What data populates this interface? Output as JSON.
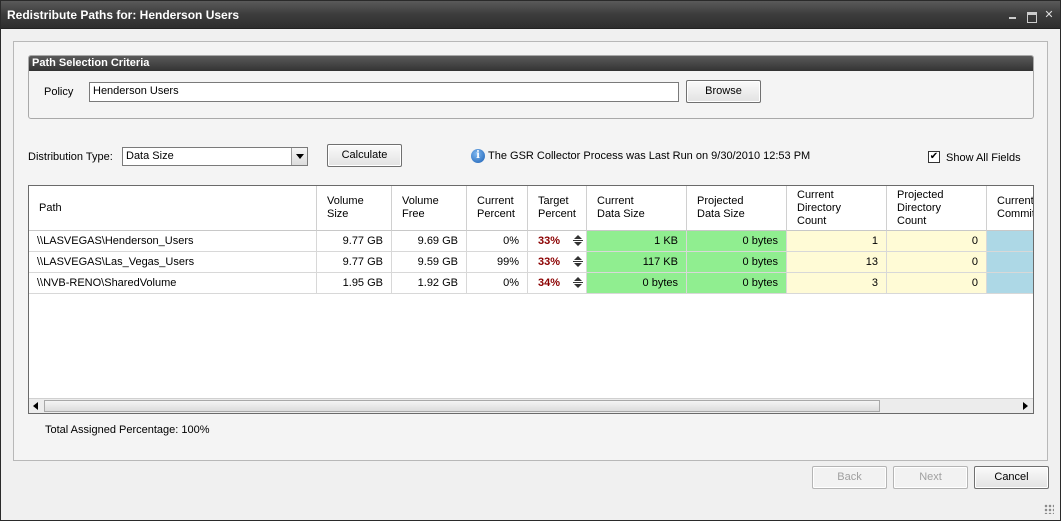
{
  "window": {
    "title": "Redistribute Paths for: Henderson Users"
  },
  "criteria": {
    "header": "Path Selection Criteria",
    "policy_label": "Policy",
    "policy_value": "Henderson Users",
    "browse_label": "Browse"
  },
  "distribution": {
    "label": "Distribution Type:",
    "selected": "Data Size",
    "calculate_label": "Calculate"
  },
  "info_message": "The GSR Collector Process was Last Run on 9/30/2010 12:53 PM",
  "show_all_fields": {
    "label": "Show All Fields",
    "checked": true
  },
  "grid": {
    "columns": [
      "Path",
      "Volume\nSize",
      "Volume\nFree",
      "Current\nPercent",
      "Target\nPercent",
      "Current\nData Size",
      "Projected\nData Size",
      "Current\nDirectory\nCount",
      "Projected\nDirectory\nCount",
      "Current\nCommit"
    ],
    "rows": [
      {
        "path": "\\\\LASVEGAS\\Henderson_Users",
        "volume_size": "9.77 GB",
        "volume_free": "9.69 GB",
        "current_percent": "0%",
        "target_percent": "33%",
        "current_data_size": "1 KB",
        "projected_data_size": "0 bytes",
        "current_dir_count": "1",
        "projected_dir_count": "0"
      },
      {
        "path": "\\\\LASVEGAS\\Las_Vegas_Users",
        "volume_size": "9.77 GB",
        "volume_free": "9.59 GB",
        "current_percent": "99%",
        "target_percent": "33%",
        "current_data_size": "117 KB",
        "projected_data_size": "0 bytes",
        "current_dir_count": "13",
        "projected_dir_count": "0"
      },
      {
        "path": "\\\\NVB-RENO\\SharedVolume",
        "volume_size": "1.95 GB",
        "volume_free": "1.92 GB",
        "current_percent": "0%",
        "target_percent": "34%",
        "current_data_size": "0 bytes",
        "projected_data_size": "0 bytes",
        "current_dir_count": "3",
        "projected_dir_count": "0"
      }
    ]
  },
  "total_assigned": "Total Assigned Percentage: 100%",
  "footer": {
    "back_label": "Back",
    "next_label": "Next",
    "cancel_label": "Cancel"
  },
  "colors": {
    "data_size_cells": "#90ee90",
    "directory_count_cells": "#fffbd6",
    "commit_cells": "#add8e6",
    "target_percent_text": "#8b0000"
  }
}
